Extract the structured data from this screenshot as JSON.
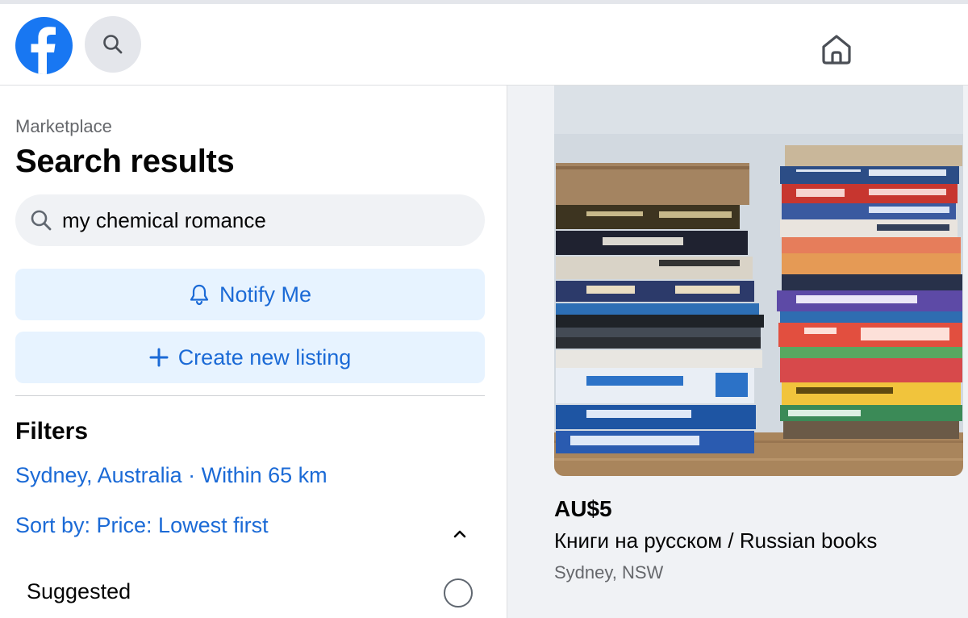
{
  "header": {
    "logo_icon": "facebook-logo-icon",
    "search_icon": "search-icon",
    "home_icon": "home-icon"
  },
  "sidebar": {
    "breadcrumb": "Marketplace",
    "title": "Search results",
    "search": {
      "value": "my chemical romance",
      "icon": "search-icon"
    },
    "notify_label": "Notify Me",
    "notify_icon": "bell-icon",
    "create_label": "Create new listing",
    "create_icon": "plus-icon",
    "filters_heading": "Filters",
    "location_filter": "Sydney, Australia · Within 65 km",
    "sort_label": "Sort by: Price: Lowest first",
    "sort_icon": "chevron-up-icon",
    "sort_options": [
      {
        "label": "Suggested",
        "selected": false
      }
    ]
  },
  "listing": {
    "price": "AU$5",
    "title": "Книги на русском / Russian books",
    "location": "Sydney, NSW",
    "image": "photo of two stacks of russian books"
  },
  "colors": {
    "brand": "#1877f2",
    "link": "#1b6ad6",
    "button_bg": "#e7f3ff",
    "page_bg": "#f0f2f5"
  }
}
